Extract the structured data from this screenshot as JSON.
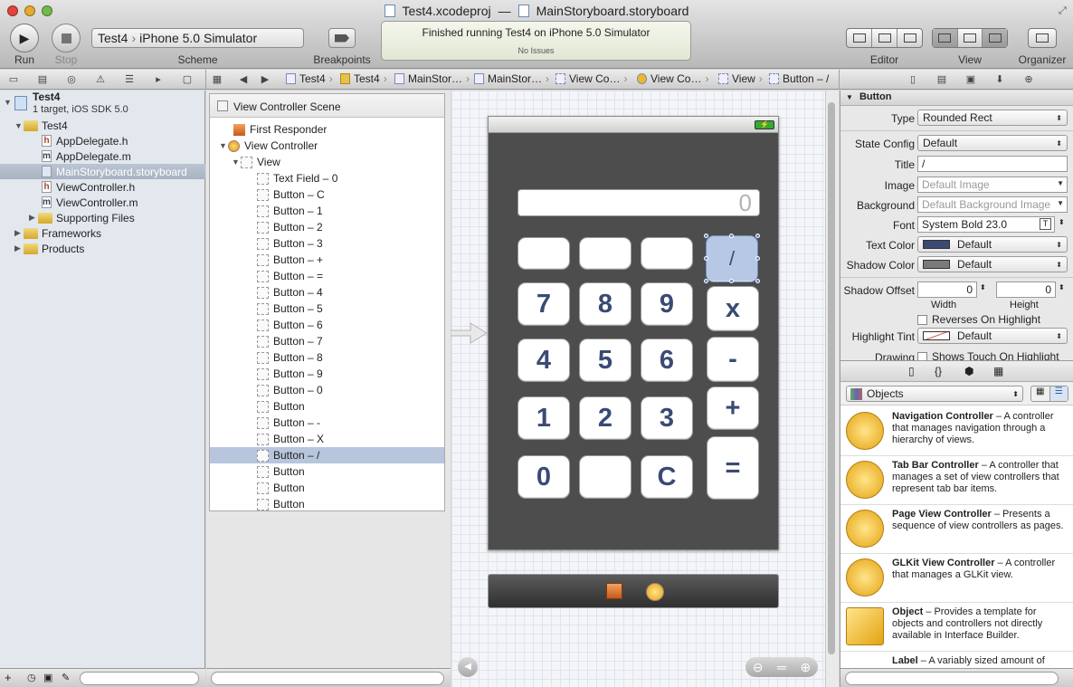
{
  "window": {
    "project": "Test4.xcodeproj",
    "separator": "—",
    "document": "MainStoryboard.storyboard"
  },
  "toolbar": {
    "run_label": "Run",
    "stop_label": "Stop",
    "scheme_label": "Scheme",
    "scheme_target": "Test4",
    "scheme_dest": "iPhone 5.0 Simulator",
    "breakpoints_label": "Breakpoints",
    "activity_status": "Finished running Test4 on iPhone 5.0 Simulator",
    "activity_issues": "No Issues",
    "editor_label": "Editor",
    "view_label": "View",
    "organizer_label": "Organizer"
  },
  "jumpbar": [
    "Test4",
    "Test4",
    "MainStor…",
    "MainStor…",
    "View Co…",
    "View Co…",
    "View",
    "Button – /"
  ],
  "navigator": {
    "project_name": "Test4",
    "project_sub": "1 target, iOS SDK 5.0",
    "items": [
      {
        "label": "Test4",
        "type": "folder"
      },
      {
        "label": "AppDelegate.h",
        "type": "h"
      },
      {
        "label": "AppDelegate.m",
        "type": "m"
      },
      {
        "label": "MainStoryboard.storyboard",
        "type": "storyboard"
      },
      {
        "label": "ViewController.h",
        "type": "h"
      },
      {
        "label": "ViewController.m",
        "type": "m"
      },
      {
        "label": "Supporting Files",
        "type": "folder"
      },
      {
        "label": "Frameworks",
        "type": "folder"
      },
      {
        "label": "Products",
        "type": "folder"
      }
    ]
  },
  "outline": {
    "scene": "View Controller Scene",
    "first_responder": "First Responder",
    "view_controller": "View Controller",
    "view": "View",
    "items": [
      "Text Field – 0",
      "Button – C",
      "Button – 1",
      "Button – 2",
      "Button – 3",
      "Button – +",
      "Button – =",
      "Button – 4",
      "Button – 5",
      "Button – 6",
      "Button – 7",
      "Button – 8",
      "Button – 9",
      "Button – 0",
      "Button",
      "Button – -",
      "Button – X",
      "Button – /",
      "Button",
      "Button",
      "Button"
    ]
  },
  "calculator": {
    "display": "0",
    "keys": {
      "blank1": "",
      "blank2": "",
      "blank3": "",
      "divide": "/",
      "k7": "7",
      "k8": "8",
      "k9": "9",
      "multiply": "x",
      "k4": "4",
      "k5": "5",
      "k6": "6",
      "minus": "-",
      "k1": "1",
      "k2": "2",
      "k3": "3",
      "plus": "+",
      "k0": "0",
      "blank4": "",
      "clear": "C",
      "equals": "="
    }
  },
  "inspector": {
    "section": "Button",
    "type_label": "Type",
    "type_value": "Rounded Rect",
    "state_label": "State Config",
    "state_value": "Default",
    "title_label": "Title",
    "title_value": "/",
    "image_label": "Image",
    "image_placeholder": "Default Image",
    "background_label": "Background",
    "background_placeholder": "Default Background Image",
    "font_label": "Font",
    "font_value": "System Bold 23.0",
    "text_color_label": "Text Color",
    "text_color_value": "Default",
    "shadow_color_label": "Shadow Color",
    "shadow_color_value": "Default",
    "shadow_offset_label": "Shadow Offset",
    "shadow_w": "0",
    "shadow_h": "0",
    "width_label": "Width",
    "height_label": "Height",
    "reverses_label": "Reverses On Highlight",
    "highlight_label": "Highlight Tint",
    "highlight_value": "Default",
    "drawing_label": "Drawing",
    "shows_touch_label": "Shows Touch On Highlight"
  },
  "library": {
    "filter": "Objects",
    "items": [
      {
        "name": "Navigation Controller",
        "desc": " – A controller that manages navigation through a hierarchy of views."
      },
      {
        "name": "Tab Bar Controller",
        "desc": " – A controller that manages a set of view controllers that represent tab bar items."
      },
      {
        "name": "Page View Controller",
        "desc": " – Presents a sequence of view controllers as pages."
      },
      {
        "name": "GLKit View Controller",
        "desc": " – A controller that manages a GLKit view."
      },
      {
        "name": "Object",
        "desc": " – Provides a template for objects and controllers not directly available in Interface Builder."
      },
      {
        "name": "Label",
        "desc": " – A variably sized amount of"
      }
    ]
  },
  "colors": {
    "accent": "#b7c8e4",
    "selection": "#a8b2c2",
    "calc_bg": "#4d4d4d"
  }
}
